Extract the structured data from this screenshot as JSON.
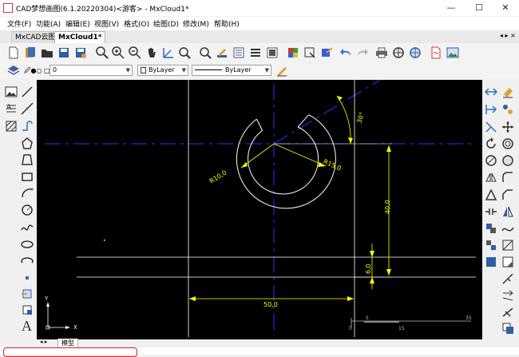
{
  "window": {
    "title": "CAD梦想画图(6.1.20220304)<游客> - MxCloud1*",
    "controls": {
      "minimize": "—",
      "maximize": "☐",
      "close": "✕"
    }
  },
  "menu": [
    "文件(F)",
    "功能(A)",
    "编辑(E)",
    "视图(V)",
    "格式(O)",
    "绘图(D)",
    "修改(M)",
    "帮助(H)"
  ],
  "tabs": [
    {
      "label": "MxCAD云图"
    },
    {
      "label": "MxCloud1*"
    }
  ],
  "tab_nav": "◂ ▸ ×",
  "properties_bar": {
    "layer": "0",
    "color": "ByLayer",
    "linetype": "ByLayer"
  },
  "drawing": {
    "dimensions": {
      "angle": "30°",
      "radius_inner": "R10,0",
      "radius_outer": "R15,0",
      "vertical_40": "40,0",
      "vertical_6": "6,0",
      "horizontal_50": "50,0"
    },
    "ucs": {
      "x": "X",
      "y": "Y"
    },
    "scale_bar": [
      "0",
      "5",
      "15",
      "35"
    ]
  },
  "layout_tabs": {
    "nav": "◂ ▸",
    "model": "模型"
  },
  "colors": {
    "canvas": "#000000",
    "geometry": "#ffffff",
    "dimension": "#ffff00",
    "center_line": "#3030ff",
    "command_highlight": "#e02020"
  }
}
